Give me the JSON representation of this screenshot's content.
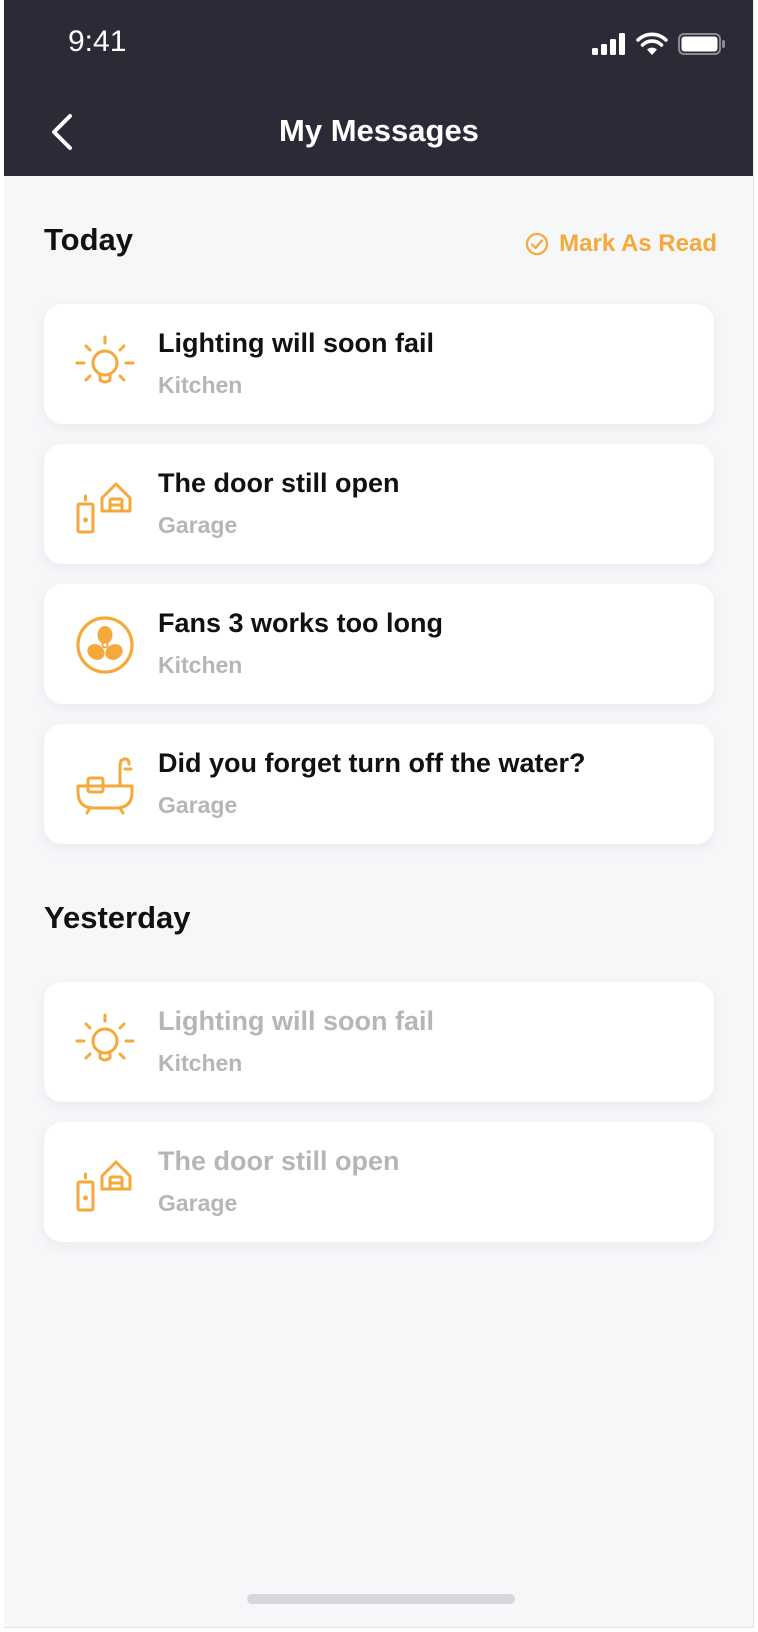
{
  "status_bar": {
    "time": "9:41"
  },
  "header": {
    "title": "My Messages"
  },
  "accent_color": "#f4a93a",
  "sections": {
    "today": {
      "label": "Today",
      "action_label": "Mark As Read",
      "items": [
        {
          "title": "Lighting will soon fail",
          "location": "Kitchen",
          "icon": "lightbulb-icon"
        },
        {
          "title": "The door still open",
          "location": "Garage",
          "icon": "door-house-icon"
        },
        {
          "title": "Fans 3 works too long",
          "location": "Kitchen",
          "icon": "fan-icon"
        },
        {
          "title": "Did you forget turn off the water?",
          "location": "Garage",
          "icon": "bathtub-icon"
        }
      ]
    },
    "yesterday": {
      "label": "Yesterday",
      "items": [
        {
          "title": "Lighting will soon fail",
          "location": "Kitchen",
          "icon": "lightbulb-icon"
        },
        {
          "title": "The door still open",
          "location": "Garage",
          "icon": "door-house-icon"
        }
      ]
    }
  }
}
